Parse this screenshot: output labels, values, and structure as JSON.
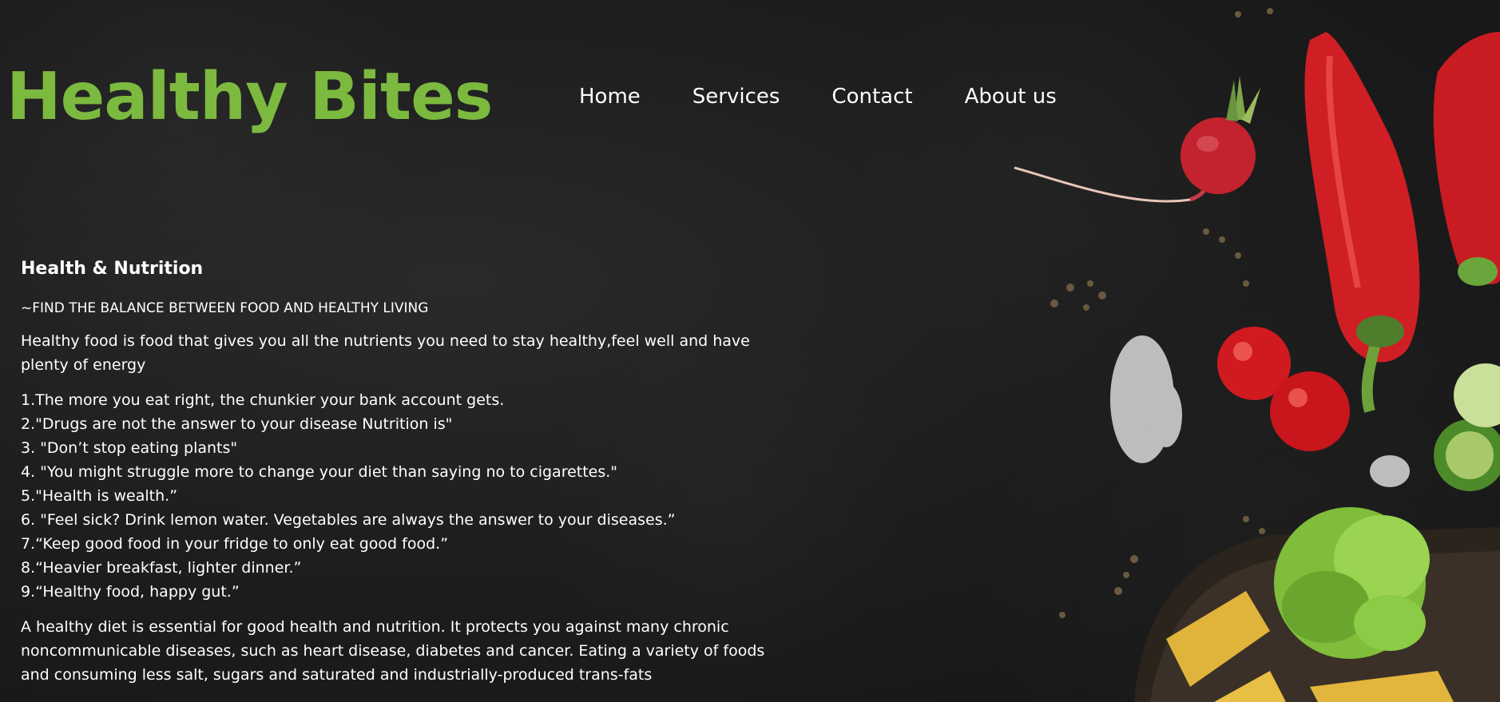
{
  "brand": {
    "title": "Healthy Bites",
    "color": "#7cb93f"
  },
  "nav": {
    "items": [
      {
        "label": "Home"
      },
      {
        "label": "Services"
      },
      {
        "label": "Contact"
      },
      {
        "label": "About us"
      }
    ]
  },
  "content": {
    "heading": "Health & Nutrition",
    "tagline": "~FIND THE BALANCE BETWEEN FOOD AND HEALTHY LIVING",
    "intro": "Healthy food is food that gives you all the nutrients you need to stay healthy,feel well and have plenty of energy",
    "quotes": [
      "1.The more you eat right, the chunkier your bank account gets.",
      "2.\"Drugs are not the answer to your disease Nutrition is\"",
      "3. \"Don’t stop eating plants\"",
      "4. \"You might struggle more to change your diet than saying no to cigarettes.\"",
      "5.\"Health is wealth.”",
      "6. \"Feel sick? Drink lemon water. Vegetables are always the answer to your diseases.”",
      "7.“Keep good food in your fridge to only eat good food.”",
      "8.“Heavier breakfast, lighter dinner.”",
      "9.“Healthy food, happy gut.”"
    ],
    "outro": "A healthy diet is essential for good health and nutrition. It protects you against many chronic noncommunicable diseases, such as heart disease, diabetes and cancer. Eating a variety of foods and consuming less salt, sugars and saturated and industrially-produced trans-fats"
  },
  "colors": {
    "background": "#1b1b1b",
    "text": "#ffffff",
    "accent": "#7cb93f"
  },
  "background_image": "vegetables-on-dark-slate"
}
